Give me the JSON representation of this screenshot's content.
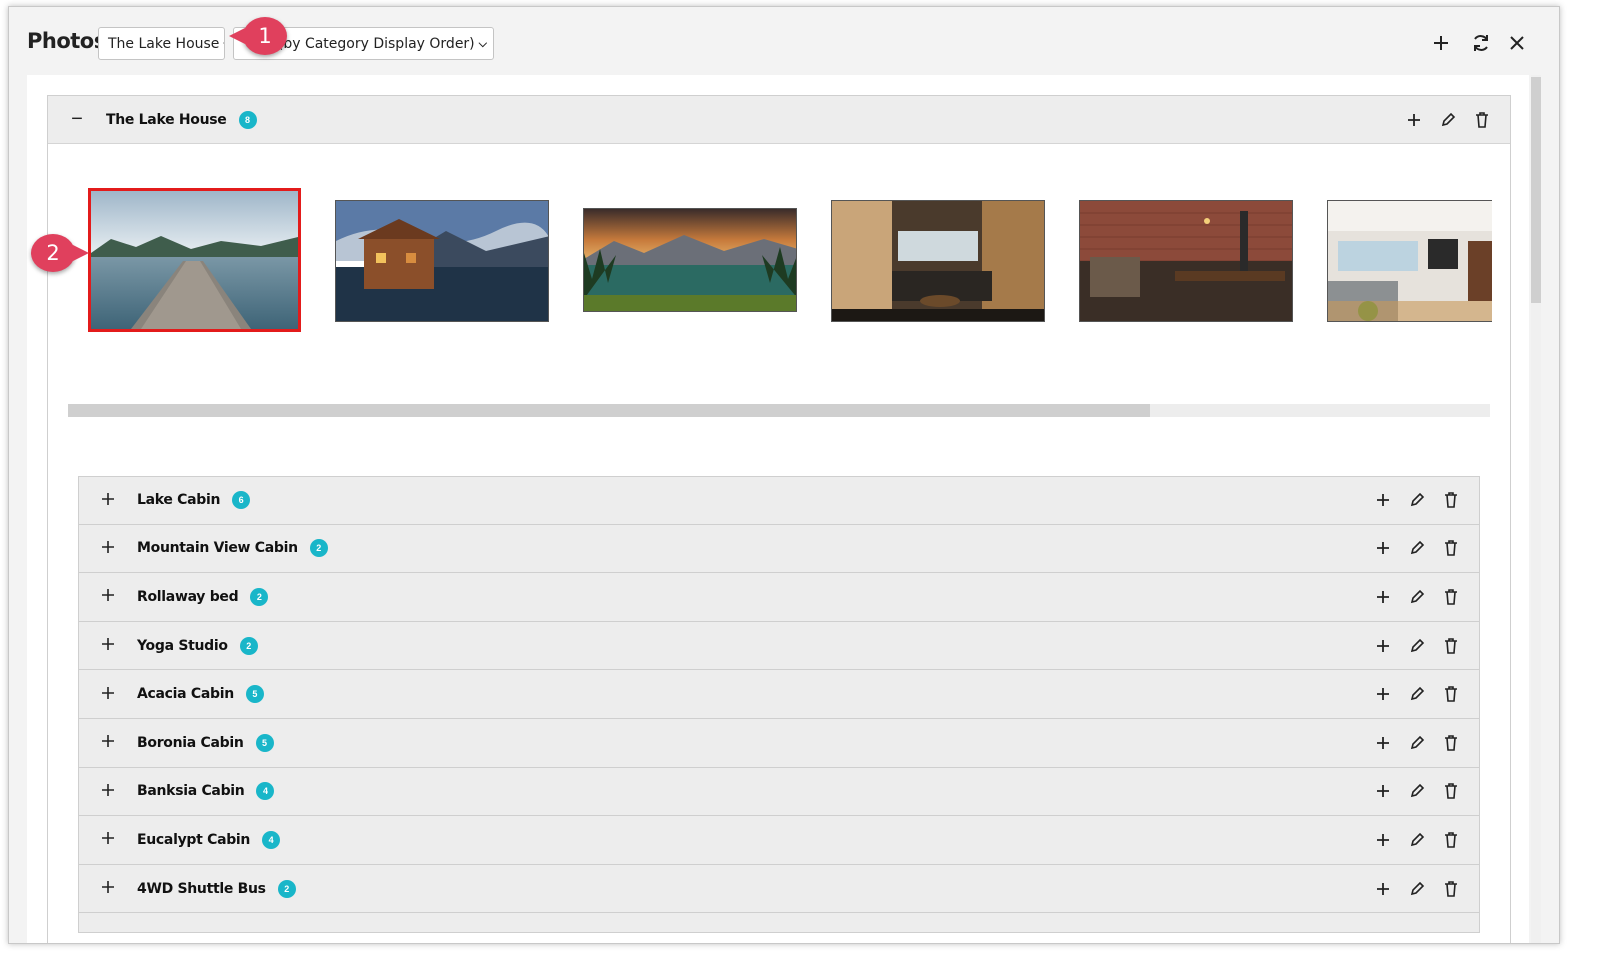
{
  "window": {
    "title": "Photos",
    "property_select": "The Lake House",
    "sort_select": "y (by Category Display Order)"
  },
  "toolbar_icons": [
    "plus-icon",
    "refresh-icon",
    "close-icon"
  ],
  "callouts": [
    "1",
    "2"
  ],
  "main_category": {
    "name": "The Lake House",
    "count": "8",
    "toggle": "−"
  },
  "photos": [
    {
      "name": "dock-lake-photo",
      "selected": true
    },
    {
      "name": "boathouse-photo",
      "selected": false
    },
    {
      "name": "mountain-lake-sunset-photo",
      "selected": false
    },
    {
      "name": "living-room-photo",
      "selected": false
    },
    {
      "name": "brick-kitchen-photo",
      "selected": false
    },
    {
      "name": "lounge-photo",
      "selected": false
    }
  ],
  "subcategories": [
    {
      "name": "Lake Cabin",
      "count": "6"
    },
    {
      "name": "Mountain View Cabin",
      "count": "2"
    },
    {
      "name": "Rollaway bed",
      "count": "2"
    },
    {
      "name": "Yoga Studio",
      "count": "2"
    },
    {
      "name": "Acacia Cabin",
      "count": "5"
    },
    {
      "name": "Boronia Cabin",
      "count": "5"
    },
    {
      "name": "Banksia Cabin",
      "count": "4"
    },
    {
      "name": "Eucalypt Cabin",
      "count": "4"
    },
    {
      "name": "4WD Shuttle Bus",
      "count": "2"
    }
  ],
  "colors": {
    "badge": "#19b6c9",
    "callout": "#e0405d",
    "selected_border": "#e31b1b"
  }
}
